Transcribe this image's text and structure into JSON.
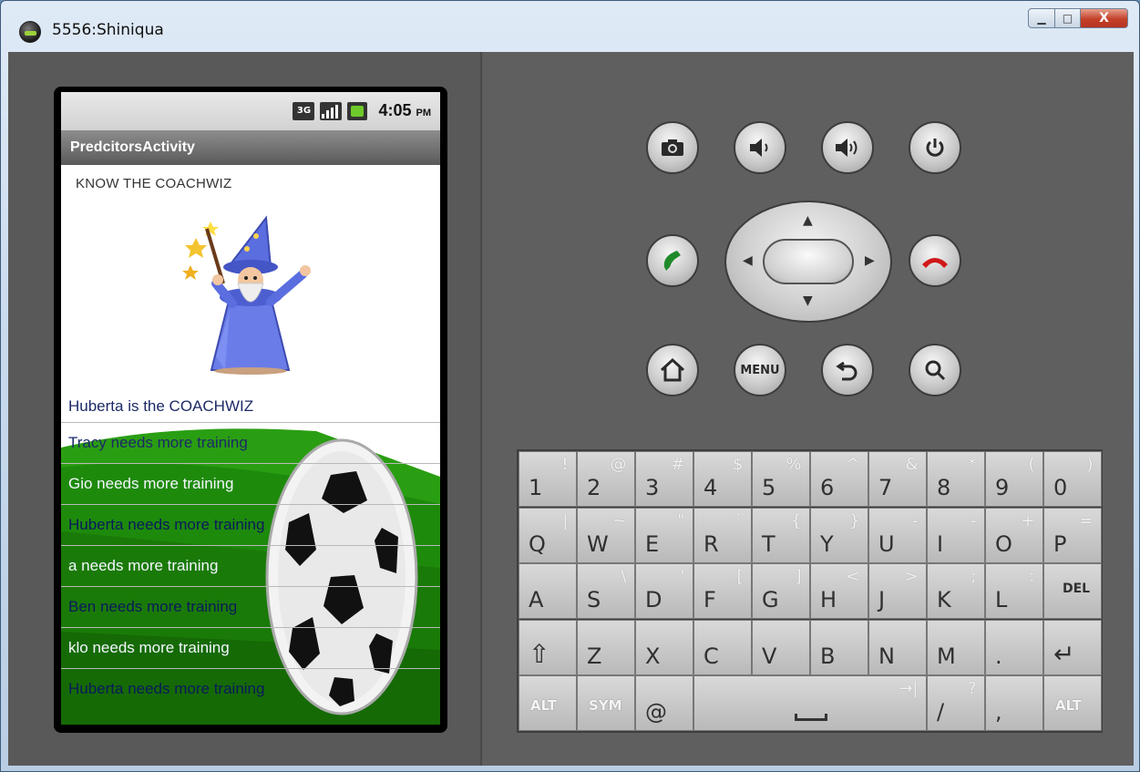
{
  "window": {
    "title": "5556:Shiniqua",
    "minimize_label": "▁",
    "maximize_label": "□",
    "close_label": "X"
  },
  "statusbar": {
    "network": "3G",
    "time": "4:05",
    "ampm": "PM"
  },
  "app": {
    "title": "PredcitorsActivity",
    "heading": "KNOW THE COACHWIZ",
    "coachwiz_text": "Huberta  is the COACHWIZ",
    "list_items": [
      "Tracy  needs more training",
      "Gio  needs more training",
      "Huberta  needs more training",
      "a  needs more training",
      "Ben  needs more training",
      "klo  needs more training",
      "Huberta  needs more training"
    ]
  },
  "hardware": {
    "menu_label": "MENU",
    "icons": [
      "camera-icon",
      "volume-down-icon",
      "volume-up-icon",
      "power-icon",
      "call-icon",
      "end-call-icon",
      "home-icon",
      "back-icon",
      "search-icon"
    ]
  },
  "keyboard": {
    "row1": [
      {
        "main": "1",
        "alt": "!"
      },
      {
        "main": "2",
        "alt": "@"
      },
      {
        "main": "3",
        "alt": "#"
      },
      {
        "main": "4",
        "alt": "$"
      },
      {
        "main": "5",
        "alt": "%"
      },
      {
        "main": "6",
        "alt": "^"
      },
      {
        "main": "7",
        "alt": "&"
      },
      {
        "main": "8",
        "alt": "*"
      },
      {
        "main": "9",
        "alt": "("
      },
      {
        "main": "0",
        "alt": ")"
      }
    ],
    "row2": [
      {
        "main": "Q",
        "alt": "|"
      },
      {
        "main": "W",
        "alt": "~"
      },
      {
        "main": "E",
        "alt": "\""
      },
      {
        "main": "R",
        "alt": "`"
      },
      {
        "main": "T",
        "alt": "{"
      },
      {
        "main": "Y",
        "alt": "}"
      },
      {
        "main": "U",
        "alt": "-"
      },
      {
        "main": "I",
        "alt": "-"
      },
      {
        "main": "O",
        "alt": "+"
      },
      {
        "main": "P",
        "alt": "="
      }
    ],
    "row3": [
      {
        "main": "A",
        "alt": ""
      },
      {
        "main": "S",
        "alt": "\\"
      },
      {
        "main": "D",
        "alt": "'"
      },
      {
        "main": "F",
        "alt": "["
      },
      {
        "main": "G",
        "alt": "]"
      },
      {
        "main": "H",
        "alt": "<"
      },
      {
        "main": "J",
        "alt": ">"
      },
      {
        "main": "K",
        "alt": ";"
      },
      {
        "main": "L",
        "alt": ":"
      },
      {
        "main": "DEL",
        "alt": ""
      }
    ],
    "row4": [
      {
        "main": "⇧",
        "alt": ""
      },
      {
        "main": "Z",
        "alt": ""
      },
      {
        "main": "X",
        "alt": ""
      },
      {
        "main": "C",
        "alt": ""
      },
      {
        "main": "V",
        "alt": ""
      },
      {
        "main": "B",
        "alt": ""
      },
      {
        "main": "N",
        "alt": ""
      },
      {
        "main": "M",
        "alt": ""
      },
      {
        "main": ".",
        "alt": ""
      },
      {
        "main": "↵",
        "alt": ""
      }
    ],
    "row5": {
      "alt_left": "ALT",
      "sym": "SYM",
      "at": "@",
      "space_alt": "→|",
      "slash": "/",
      "slash_alt": "?",
      "comma": ",",
      "alt_right": "ALT"
    }
  }
}
